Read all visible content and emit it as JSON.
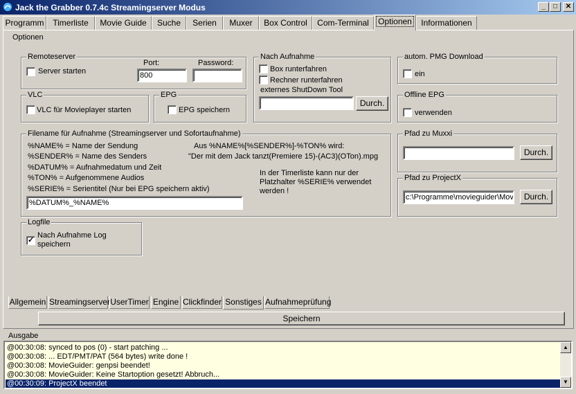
{
  "window": {
    "title": "Jack the Grabber 0.7.4c Streamingserver Modus"
  },
  "main_tabs": [
    "Programm",
    "Timerliste",
    "Movie Guide",
    "Suche",
    "Serien",
    "Muxer",
    "Box Control",
    "Com-Terminal",
    "Optionen",
    "Informationen"
  ],
  "active_main_tab": "Optionen",
  "panel_title": "Optionen",
  "remoteserver": {
    "title": "Remoteserver",
    "start_label": "Server starten",
    "port_label": "Port:",
    "port_value": "800",
    "password_label": "Password:",
    "password_value": ""
  },
  "vlc": {
    "title": "VLC",
    "label": "VLC für Movieplayer starten"
  },
  "epg": {
    "title": "EPG",
    "label": "EPG speichern"
  },
  "nach_aufnahme": {
    "title": "Nach Aufnahme",
    "box_label": "Box runterfahren",
    "rechner_label": "Rechner runterfahren",
    "tool_label": "externes ShutDown Tool",
    "tool_value": "",
    "browse_label": "Durch."
  },
  "pmg": {
    "title": "autom. PMG Download",
    "label": "ein"
  },
  "offline_epg": {
    "title": "Offline EPG",
    "label": "verwenden"
  },
  "filename": {
    "title": "Filename  für  Aufnahme  (Streamingserver  und  Sofortaufnahme)",
    "line1": "%NAME% = Name der Sendung",
    "line2": "%SENDER% = Name des Senders",
    "line3": "%DATUM% = Aufnahmedatum und Zeit",
    "line4": "%TON% = Aufgenommene Audios",
    "line5": "%SERIE% = Serientitel (Nur bei EPG  speichern aktiv)",
    "example1": "Aus  %NAME%[%SENDER%]-%TON%  wird:",
    "example2": "\"Der mit  dem Jack  tanzt(Premiere 15)-(AC3)(OTon).mpg",
    "note": "In der Timerliste kann nur der Platzhalter %SERIE% verwendet werden !",
    "value": "%DATUM%_%NAME%"
  },
  "muxxi": {
    "title": "Pfad zu Muxxi",
    "value": "",
    "browse_label": "Durch."
  },
  "projectx": {
    "title": "Pfad zu ProjectX",
    "value": "c:\\Programme\\movieguider\\Mov",
    "browse_label": "Durch."
  },
  "logfile": {
    "title": "Logfile",
    "label_line1": "Nach Aufnahme Log",
    "label_line2": "speichern",
    "checked": true
  },
  "sub_tabs": [
    "Allgemein",
    "Streamingserver",
    "UserTimer",
    "Engine",
    "Clickfinder",
    "Sonstiges",
    "Aufnahmeprüfung"
  ],
  "active_sub_tab": "Sonstiges",
  "save_label": "Speichern",
  "output": {
    "title": "Ausgabe",
    "lines": [
      "@00:30:08: synced to pos (0) - start patching ...",
      "@00:30:08: ... EDT/PMT/PAT (564 bytes) write done !",
      "@00:30:08: MovieGuider: genpsi beendet!",
      "@00:30:08: MovieGuider: Keine Startoption gesetzt! Abbruch...",
      "@00:30:09: ProjectX beendet"
    ]
  },
  "colors": {
    "titlebar_start": "#0a246a",
    "titlebar_end": "#a6caf0",
    "selection": "#0a246a",
    "log_background": "#ffffe1"
  }
}
